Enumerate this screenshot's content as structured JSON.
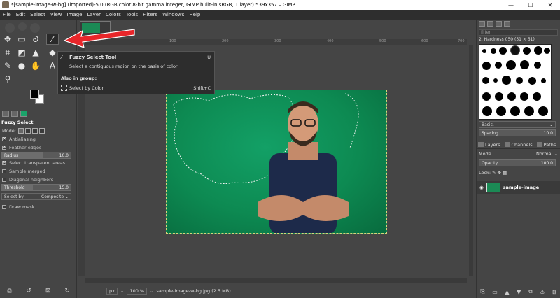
{
  "window": {
    "title": "*[sample-image-w-bg] (imported)-5.0 (RGB color 8-bit gamma integer, GIMP built-in sRGB, 1 layer) 539x357 – GIMP",
    "minimize": "—",
    "maximize": "☐",
    "close": "✕"
  },
  "menu": [
    "File",
    "Edit",
    "Select",
    "View",
    "Image",
    "Layer",
    "Colors",
    "Tools",
    "Filters",
    "Windows",
    "Help"
  ],
  "tool_options": {
    "title": "Fuzzy Select",
    "mode_label": "Mode:",
    "antialiasing": "Antialiasing",
    "feather_edges": "Feather edges",
    "radius_label": "Radius",
    "radius_value": "10.0",
    "select_transparent": "Select transparent areas",
    "sample_merged": "Sample merged",
    "diagonal_neighbors": "Diagonal neighbors",
    "threshold_label": "Threshold",
    "threshold_value": "15.0",
    "select_by_label": "Select by",
    "select_by_value": "Composite",
    "draw_mask": "Draw mask"
  },
  "tooltip": {
    "title": "Fuzzy Select Tool",
    "shortcut": "U",
    "description": "Select a contiguous region on the basis of color",
    "group_label": "Also in group:",
    "group_item": "Select by Color",
    "group_shortcut": "Shift+C"
  },
  "status": {
    "unit": "px",
    "zoom": "100 %",
    "file": "sample-image-w-bg.jpg (2.5 MB)"
  },
  "ruler_ticks": [
    "100",
    "200",
    "300",
    "400",
    "500",
    "600",
    "700"
  ],
  "brushes": {
    "filter_placeholder": "filter",
    "name": "2. Hardness 050 (51 × 51)",
    "preset": "Basic,",
    "spacing_label": "Spacing",
    "spacing_value": "10.0"
  },
  "layers": {
    "tabs": [
      "Layers",
      "Channels",
      "Paths"
    ],
    "mode_label": "Mode",
    "mode_value": "Normal",
    "opacity_label": "Opacity",
    "opacity_value": "100.0",
    "lock_label": "Lock:",
    "layer_name": "sample-image"
  },
  "colors": {
    "canvas_bg": "#0f8b57",
    "arrow": "#e8262a",
    "panel": "#454545"
  }
}
